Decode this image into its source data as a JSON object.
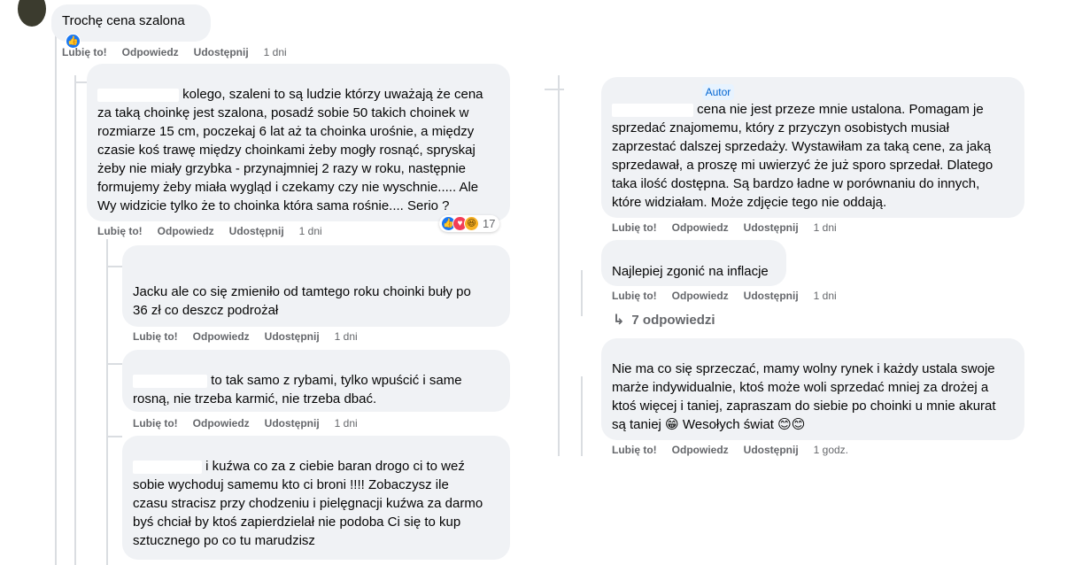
{
  "meta": {
    "badge_author": "Autor"
  },
  "actions": {
    "like": "Lubię to!",
    "reply": "Odpowiedz",
    "share": "Udostępnij"
  },
  "left": {
    "c0": {
      "author": "",
      "text": "Trochę cena szalona",
      "time": "1 dni"
    },
    "c1": {
      "author": "",
      "lines": [
        "kolego, szaleni to są ludzie którzy uważają że cena",
        "za taką choinkę jest szalona, posadź sobie 50 takich choinek w",
        "rozmiarze 15 cm, poczekaj 6 lat aż ta choinka urośnie, a między",
        "czasie koś trawę między choinkami żeby mogły rosnąć, spryskaj",
        "żeby nie miały grzybka - przynajmniej 2 razy w roku, następnie",
        "formujemy żeby miała wygląd i czekamy czy nie wyschnie..... Ale",
        "Wy widzicie tylko że to choinka która sama rośnie.... Serio ?"
      ],
      "reactions_count": "17",
      "time": "1 dni"
    },
    "c2": {
      "author": "",
      "lines": [
        "Jacku ale co się zmieniło od tamtego roku choinki buły po",
        "36 zł co deszcz podrożał"
      ],
      "time": "1 dni"
    },
    "c3": {
      "author": "",
      "lines": [
        "to tak samo z rybami, tylko wpuścić i same",
        "rosną, nie trzeba karmić, nie trzeba dbać."
      ],
      "time": "1 dni"
    },
    "c4": {
      "author": "",
      "lines": [
        "i kuźwa co za z ciebie baran drogo ci to weź",
        "sobie wychoduj samemu kto ci broni !!!! Zobaczysz ile",
        "czasu stracisz przy chodzeniu i pielęgnacji kuźwa za darmo",
        "byś chciał by ktoś zapierdzielał nie podoba Ci się to kup",
        "sztucznego po co tu marudzisz"
      ]
    }
  },
  "right": {
    "r1": {
      "author": "",
      "lines": [
        "cena nie jest przeze mnie ustalona. Pomagam je",
        "sprzedać znajomemu, który z przyczyn osobistych musiał",
        "zaprzestać dalszej sprzedaży. Wystawiłam za taką cene, za jaką",
        "sprzedawał, a proszę mi uwierzyć że już sporo sprzedał. Dlatego",
        "taka ilość dostępna. Są bardzo ładne w porównaniu do innych,",
        "które widziałam. Może zdjęcie tego nie oddają."
      ],
      "time": "1 dni"
    },
    "r2": {
      "author": "",
      "text": "Najlepiej zgonić na inflacje",
      "time": "1 dni",
      "replies": "7 odpowiedzi"
    },
    "r3": {
      "author": "",
      "lines": [
        "Nie ma co się sprzeczać, mamy wolny rynek i każdy ustala swoje",
        "marże indywidualnie, ktoś może woli sprzedać mniej za drożej a",
        "ktoś więcej i taniej, zapraszam do siebie po choinki u mnie akurat",
        "są taniej"
      ],
      "tail_text": "Wesołych świat",
      "time": "1 godz."
    }
  }
}
